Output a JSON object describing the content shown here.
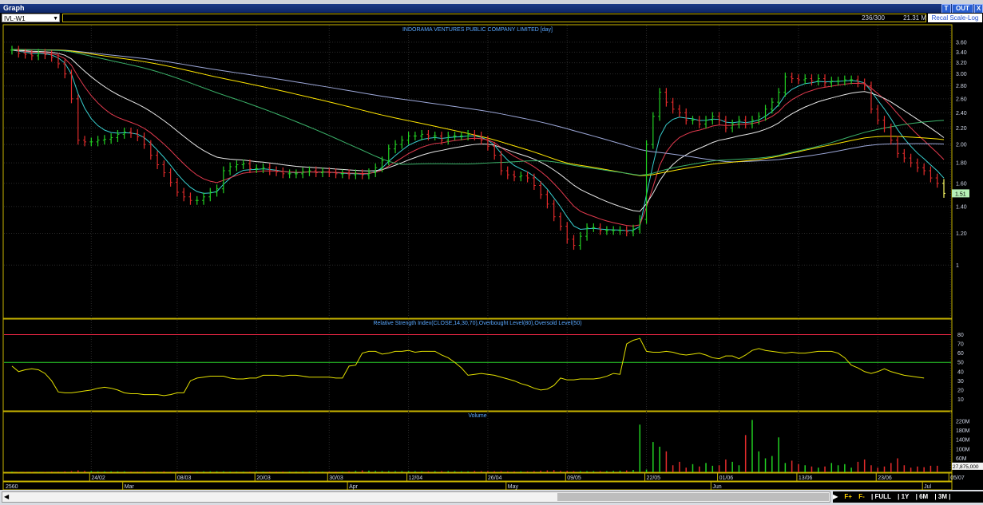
{
  "window": {
    "title": "Graph",
    "buttons": {
      "t": "T",
      "out": "OUT",
      "x": "X"
    }
  },
  "toolbar": {
    "symbol": "IVL-W1",
    "count": "236/300",
    "mktcap": "21.31 M",
    "recal": "Recal Scale-Log"
  },
  "colors": {
    "bg": "#000000",
    "frame": "#c8b400",
    "up": "#22d122",
    "down": "#e32b2b",
    "lastbar": "#ffff66",
    "ma_fast": "#38d0d0",
    "ma_mid": "#e33a4e",
    "ma_slow": "#e8e8e8",
    "ma_200": "#ffe600",
    "ma_150": "#3bb36a",
    "ma_100": "#9da8d9",
    "rsi": "#e3e000",
    "ob": "#ff2a4a",
    "os": "#2ad12a"
  },
  "chart_data": [
    {
      "type": "candlestick",
      "title": "INDORAMA VENTURES PUBLIC COMPANY LIMITED [day]",
      "yscale": "log",
      "ylim": [
        0.75,
        3.75
      ],
      "yticks": [
        "3.60",
        "3.40",
        "3.20",
        "3.00",
        "2.80",
        "2.60",
        "2.40",
        "2.20",
        "2.00",
        "1.80",
        "1.60",
        "1.40",
        "1.20",
        "1"
      ],
      "ytick_values": [
        3.6,
        3.4,
        3.2,
        3.0,
        2.8,
        2.6,
        2.4,
        2.2,
        2.0,
        1.8,
        1.6,
        1.4,
        1.2,
        1.0
      ],
      "last_price": "1.51",
      "last_value": 1.51,
      "x_labels": [
        "24/02",
        "08/03",
        "20/03",
        "30/03",
        "12/04",
        "26/04",
        "09/05",
        "22/05",
        "01/06",
        "13/06",
        "23/06",
        "05/07"
      ],
      "x_label_index": [
        12,
        25,
        37,
        48,
        60,
        72,
        84,
        96,
        107,
        119,
        131,
        142
      ],
      "month_labels": [
        "2560",
        "Mar",
        "Apr",
        "May",
        "Jun",
        "Jul"
      ],
      "month_label_index": [
        0,
        17,
        51,
        75,
        106,
        138
      ],
      "close": [
        3.44,
        3.38,
        3.36,
        3.33,
        3.38,
        3.35,
        3.3,
        3.18,
        3.0,
        2.6,
        2.05,
        2.03,
        2.03,
        2.05,
        2.06,
        2.08,
        2.12,
        2.15,
        2.13,
        2.09,
        2.0,
        1.88,
        1.78,
        1.7,
        1.61,
        1.52,
        1.48,
        1.45,
        1.45,
        1.48,
        1.52,
        1.55,
        1.72,
        1.76,
        1.78,
        1.79,
        1.74,
        1.74,
        1.75,
        1.72,
        1.71,
        1.69,
        1.69,
        1.69,
        1.71,
        1.72,
        1.7,
        1.71,
        1.7,
        1.69,
        1.69,
        1.68,
        1.69,
        1.68,
        1.7,
        1.75,
        1.82,
        1.95,
        2.0,
        2.05,
        2.1,
        2.1,
        2.12,
        2.1,
        2.1,
        2.05,
        2.1,
        2.1,
        2.1,
        2.12,
        2.1,
        2.05,
        1.98,
        1.88,
        1.72,
        1.68,
        1.66,
        1.67,
        1.65,
        1.58,
        1.5,
        1.42,
        1.32,
        1.25,
        1.16,
        1.12,
        1.18,
        1.24,
        1.24,
        1.22,
        1.22,
        1.22,
        1.22,
        1.21,
        1.23,
        1.3,
        2.0,
        2.35,
        2.7,
        2.55,
        2.45,
        2.4,
        2.3,
        2.3,
        2.25,
        2.3,
        2.35,
        2.3,
        2.2,
        2.25,
        2.3,
        2.25,
        2.3,
        2.35,
        2.45,
        2.55,
        2.7,
        2.95,
        2.92,
        2.9,
        2.92,
        2.88,
        2.92,
        2.85,
        2.88,
        2.88,
        2.9,
        2.9,
        2.85,
        2.8,
        2.45,
        2.3,
        2.2,
        2.05,
        1.9,
        1.85,
        1.8,
        1.75,
        1.72,
        1.65,
        1.6,
        1.51
      ],
      "rsi_series": {
        "name": "Relative Strength Index(CLOSE,14,30,70),Overbought Level(80),Oversold Level(50)",
        "ylim": [
          0,
          90
        ],
        "yticks": [
          80,
          70,
          60,
          50,
          40,
          30,
          20,
          10
        ],
        "overbought": 80,
        "oversold": 50,
        "values": [
          46,
          40,
          42,
          43,
          42,
          38,
          30,
          18,
          17,
          17,
          18,
          19,
          20,
          22,
          23,
          22,
          20,
          17,
          16,
          16,
          15,
          15,
          15,
          14,
          15,
          17,
          17,
          30,
          33,
          34,
          35,
          35,
          35,
          33,
          32,
          32,
          33,
          33,
          36,
          36,
          36,
          35,
          36,
          36,
          35,
          34,
          34,
          34,
          34,
          33,
          33,
          46,
          47,
          60,
          62,
          62,
          59,
          60,
          62,
          62,
          63,
          61,
          62,
          62,
          62,
          58,
          55,
          50,
          44,
          36,
          37,
          38,
          37,
          36,
          34,
          32,
          30,
          27,
          25,
          22,
          20,
          21,
          25,
          33,
          31,
          31,
          32,
          32,
          32,
          33,
          35,
          38,
          37,
          70,
          74,
          76,
          62,
          61,
          61,
          62,
          61,
          59,
          58,
          59,
          60,
          58,
          55,
          54,
          57,
          57,
          54,
          58,
          63,
          65,
          63,
          62,
          61,
          60,
          61,
          60,
          60,
          61,
          62,
          62,
          62,
          60,
          55,
          47,
          44,
          40,
          38,
          40,
          43,
          40,
          38,
          36,
          35,
          34,
          33
        ]
      },
      "volume_series": {
        "name": "Volume",
        "yticks": [
          "220M",
          "180M",
          "140M",
          "100M",
          "60M"
        ],
        "ytick_values": [
          220,
          180,
          140,
          100,
          60
        ],
        "last_volume": "27,875,000",
        "last_volume_m": 27.875,
        "values_m": [
          3,
          2,
          2,
          2,
          2,
          2,
          3,
          3,
          4,
          5,
          8,
          6,
          5,
          4,
          4,
          4,
          4,
          4,
          3,
          3,
          3,
          3,
          3,
          4,
          3,
          3,
          3,
          3,
          3,
          4,
          4,
          4,
          4,
          3,
          3,
          3,
          3,
          3,
          3,
          3,
          3,
          3,
          3,
          3,
          3,
          3,
          3,
          3,
          3,
          3,
          3,
          4,
          6,
          8,
          7,
          6,
          5,
          5,
          5,
          5,
          5,
          5,
          4,
          4,
          5,
          5,
          5,
          5,
          4,
          4,
          6,
          5,
          5,
          5,
          5,
          4,
          4,
          4,
          4,
          5,
          7,
          8,
          9,
          6,
          6,
          5,
          5,
          5,
          5,
          5,
          5,
          6,
          7,
          8,
          10,
          205,
          12,
          130,
          110,
          90,
          30,
          45,
          20,
          35,
          25,
          40,
          28,
          30,
          55,
          45,
          30,
          160,
          225,
          90,
          60,
          70,
          150,
          40,
          50,
          35,
          30,
          25,
          20,
          25,
          40,
          30,
          35,
          20,
          45,
          55,
          30,
          20,
          25,
          40,
          60,
          30,
          20,
          25,
          22,
          28,
          28
        ]
      }
    }
  ]
}
